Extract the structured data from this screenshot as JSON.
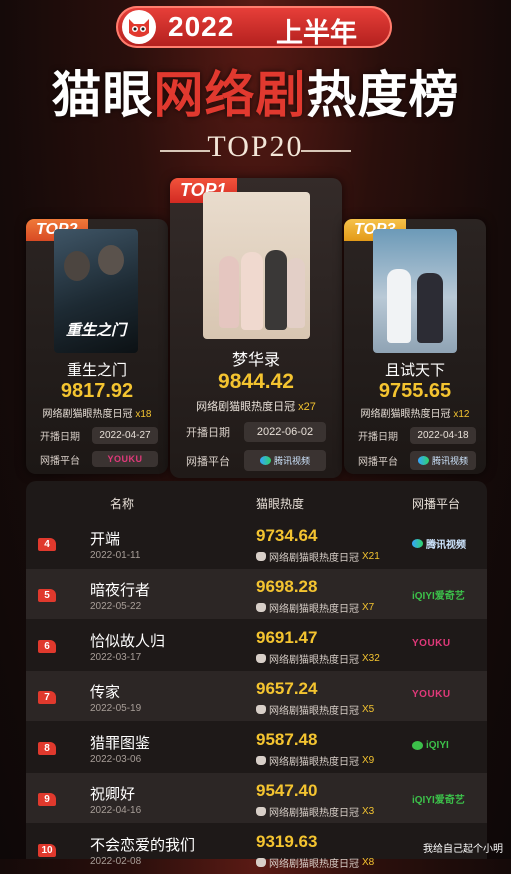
{
  "header": {
    "year": "2022",
    "half": "上半年",
    "title_white_1": "猫眼",
    "title_red": "网络剧",
    "title_white_2": "热度榜",
    "subtitle": "TOP20"
  },
  "podium": [
    {
      "rank": "TOP1",
      "title": "梦华录",
      "score": "9844.42",
      "sub": "网络剧猫眼热度日冠",
      "times": "x27",
      "date_label": "开播日期",
      "date": "2022-06-02",
      "platform_label": "网播平台",
      "platform": "腾讯视频",
      "platform_type": "tx"
    },
    {
      "rank": "TOP2",
      "title": "重生之门",
      "score": "9817.92",
      "sub": "网络剧猫眼热度日冠",
      "times": "x18",
      "date_label": "开播日期",
      "date": "2022-04-27",
      "platform_label": "网播平台",
      "platform": "YOUKU",
      "platform_type": "youku",
      "poster_text": "重生之门"
    },
    {
      "rank": "TOP3",
      "title": "且试天下",
      "score": "9755.65",
      "sub": "网络剧猫眼热度日冠",
      "times": "x12",
      "date_label": "开播日期",
      "date": "2022-04-18",
      "platform_label": "网播平台",
      "platform": "腾讯视频",
      "platform_type": "tx"
    }
  ],
  "table": {
    "headers": {
      "name": "名称",
      "score": "猫眼热度",
      "platform": "网播平台"
    },
    "rows": [
      {
        "rank": "4",
        "name": "开端",
        "date": "2022-01-11",
        "score": "9734.64",
        "sub": "网络剧猫眼热度日冠",
        "times": "X21",
        "platform": "腾讯视频",
        "platform_type": "tx"
      },
      {
        "rank": "5",
        "name": "暗夜行者",
        "date": "2022-05-22",
        "score": "9698.28",
        "sub": "网络剧猫眼热度日冠",
        "times": "X7",
        "platform": "iQIYI爱奇艺",
        "platform_type": "iqiyi"
      },
      {
        "rank": "6",
        "name": "恰似故人归",
        "date": "2022-03-17",
        "score": "9691.47",
        "sub": "网络剧猫眼热度日冠",
        "times": "X32",
        "platform": "YOUKU",
        "platform_type": "youku"
      },
      {
        "rank": "7",
        "name": "传家",
        "date": "2022-05-19",
        "score": "9657.24",
        "sub": "网络剧猫眼热度日冠",
        "times": "X5",
        "platform": "YOUKU",
        "platform_type": "youku"
      },
      {
        "rank": "8",
        "name": "猎罪图鉴",
        "date": "2022-03-06",
        "score": "9587.48",
        "sub": "网络剧猫眼热度日冠",
        "times": "X9",
        "platform": "iQIYI",
        "platform_type": "iqiyi2"
      },
      {
        "rank": "9",
        "name": "祝卿好",
        "date": "2022-04-16",
        "score": "9547.40",
        "sub": "网络剧猫眼热度日冠",
        "times": "X3",
        "platform": "iQIYI爱奇艺",
        "platform_type": "iqiyi"
      },
      {
        "rank": "10",
        "name": "不会恋爱的我们",
        "date": "2022-02-08",
        "score": "9319.63",
        "sub": "网络剧猫眼热度日冠",
        "times": "X8",
        "platform": "",
        "platform_type": ""
      }
    ]
  },
  "watermark": "我给自己起个小明",
  "colors": {
    "accent_red": "#e1392f",
    "gold": "#f4c430",
    "tag_orange": "#e9632e",
    "tag_gold": "#f2b01e"
  }
}
